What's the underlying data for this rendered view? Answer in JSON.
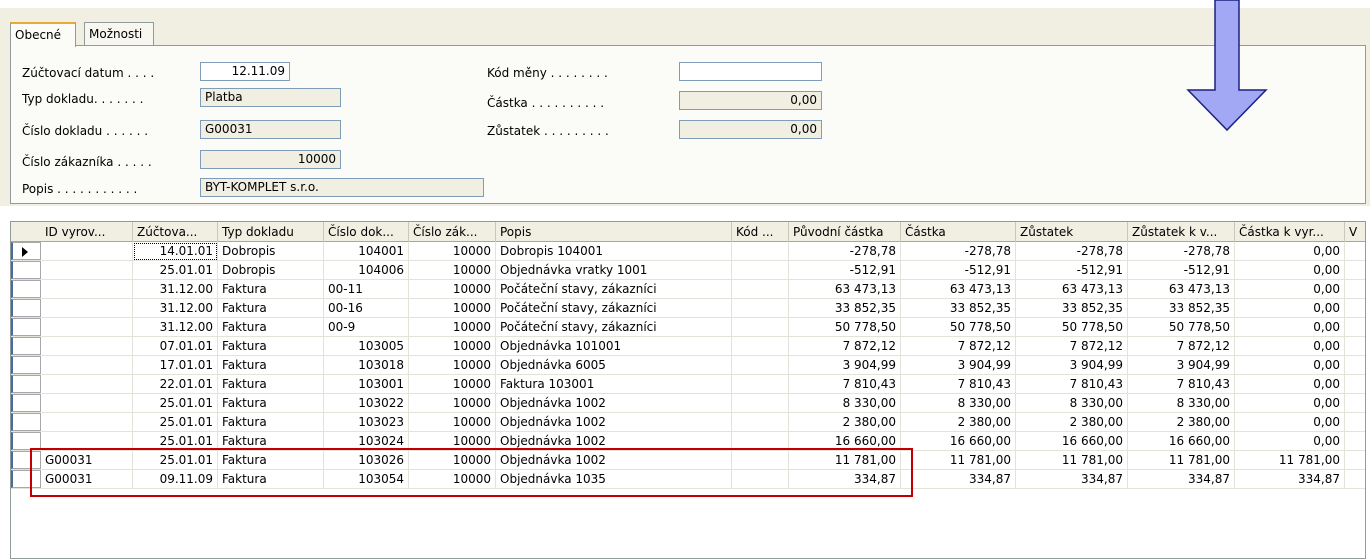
{
  "tabs": [
    {
      "label": "Obecné",
      "active": true
    },
    {
      "label": "Možnosti",
      "active": false
    }
  ],
  "form": {
    "left": [
      {
        "label": "Zúčtovací datum . . . .",
        "value": "12.11.09",
        "align": "right",
        "editable": true
      },
      {
        "label": "Typ dokladu. . . . . . .",
        "value": "Platba",
        "align": "left",
        "editable": false
      },
      {
        "label": "Číslo dokladu . . . . . .",
        "value": "G00031",
        "align": "left",
        "editable": false
      },
      {
        "label": "Číslo zákazníka . . . . .",
        "value": "10000",
        "align": "right",
        "editable": false
      },
      {
        "label": "Popis . . . . . . . . . . .",
        "value": "BYT-KOMPLET s.r.o.",
        "align": "left",
        "editable": false
      }
    ],
    "right": [
      {
        "label": "Kód měny . . . . . . . .",
        "value": "",
        "align": "left",
        "editable": true
      },
      {
        "label": "Částka . . . . . . . . . .",
        "value": "0,00",
        "align": "right",
        "editable": false
      },
      {
        "label": "Zůstatek . . . . . . . . .",
        "value": "0,00",
        "align": "right",
        "editable": false
      }
    ]
  },
  "annotation": {
    "arrow_icon": "down-arrow-icon",
    "arrow_color": "#a3a8f5",
    "highlight_color": "#c00000"
  },
  "table": {
    "headers": [
      "ID vyrov...",
      "Zúčtova...",
      "Typ dokladu",
      "Číslo dok...",
      "Číslo zák...",
      "Popis",
      "Kód ...",
      "Původní částka",
      "Částka",
      "Zůstatek",
      "Zůstatek k v...",
      "Částka k vyr...",
      "V"
    ],
    "rows": [
      [
        "",
        "14.01.01",
        "Dobropis",
        "104001",
        "10000",
        "Dobropis 104001",
        "",
        "-278,78",
        "-278,78",
        "-278,78",
        "-278,78",
        "0,00"
      ],
      [
        "",
        "25.01.01",
        "Dobropis",
        "104006",
        "10000",
        "Objednávka vratky 1001",
        "",
        "-512,91",
        "-512,91",
        "-512,91",
        "-512,91",
        "0,00"
      ],
      [
        "",
        "31.12.00",
        "Faktura",
        "00-11",
        "10000",
        "Počáteční stavy, zákazníci",
        "",
        "63 473,13",
        "63 473,13",
        "63 473,13",
        "63 473,13",
        "0,00"
      ],
      [
        "",
        "31.12.00",
        "Faktura",
        "00-16",
        "10000",
        "Počáteční stavy, zákazníci",
        "",
        "33 852,35",
        "33 852,35",
        "33 852,35",
        "33 852,35",
        "0,00"
      ],
      [
        "",
        "31.12.00",
        "Faktura",
        "00-9",
        "10000",
        "Počáteční stavy, zákazníci",
        "",
        "50 778,50",
        "50 778,50",
        "50 778,50",
        "50 778,50",
        "0,00"
      ],
      [
        "",
        "07.01.01",
        "Faktura",
        "103005",
        "10000",
        "Objednávka 101001",
        "",
        "7 872,12",
        "7 872,12",
        "7 872,12",
        "7 872,12",
        "0,00"
      ],
      [
        "",
        "17.01.01",
        "Faktura",
        "103018",
        "10000",
        "Objednávka 6005",
        "",
        "3 904,99",
        "3 904,99",
        "3 904,99",
        "3 904,99",
        "0,00"
      ],
      [
        "",
        "22.01.01",
        "Faktura",
        "103001",
        "10000",
        "Faktura 103001",
        "",
        "7 810,43",
        "7 810,43",
        "7 810,43",
        "7 810,43",
        "0,00"
      ],
      [
        "",
        "25.01.01",
        "Faktura",
        "103022",
        "10000",
        "Objednávka 1002",
        "",
        "8 330,00",
        "8 330,00",
        "8 330,00",
        "8 330,00",
        "0,00"
      ],
      [
        "",
        "25.01.01",
        "Faktura",
        "103023",
        "10000",
        "Objednávka 1002",
        "",
        "2 380,00",
        "2 380,00",
        "2 380,00",
        "2 380,00",
        "0,00"
      ],
      [
        "",
        "25.01.01",
        "Faktura",
        "103024",
        "10000",
        "Objednávka 1002",
        "",
        "16 660,00",
        "16 660,00",
        "16 660,00",
        "16 660,00",
        "0,00"
      ],
      [
        "G00031",
        "25.01.01",
        "Faktura",
        "103026",
        "10000",
        "Objednávka 1002",
        "",
        "11 781,00",
        "11 781,00",
        "11 781,00",
        "11 781,00",
        "11 781,00"
      ],
      [
        "G00031",
        "09.11.09",
        "Faktura",
        "103054",
        "10000",
        "Objednávka 1035",
        "",
        "334,87",
        "334,87",
        "334,87",
        "334,87",
        "334,87"
      ]
    ]
  }
}
